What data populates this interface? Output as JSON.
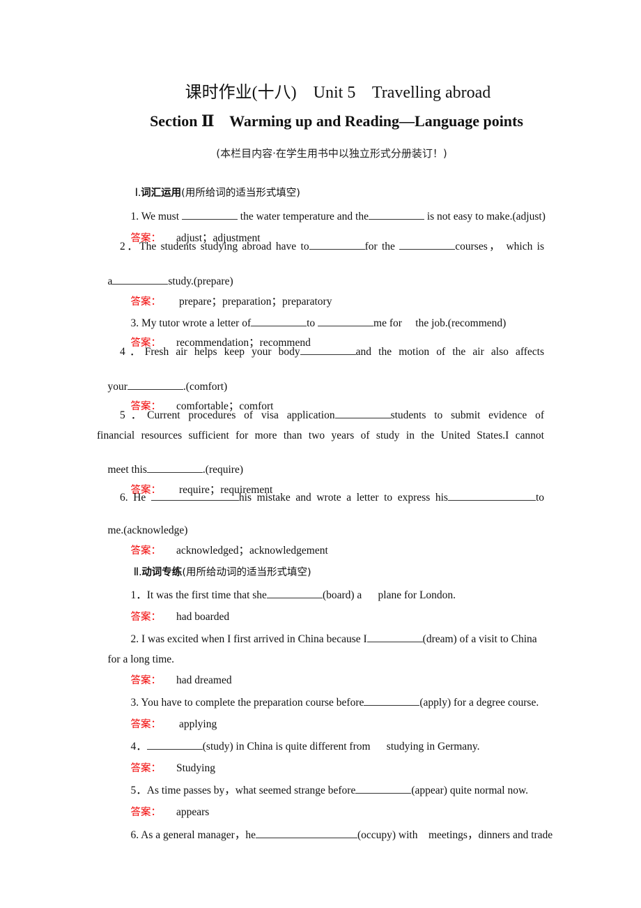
{
  "header": {
    "title": "课时作业(十八)    Unit 5    Travelling abroad",
    "subtitle": "Section Ⅱ    Warming up and Reading—Language points",
    "note": "(本栏目内容·在学生用书中以独立形式分册装订！)"
  },
  "answer_label": "答案：",
  "sections": [
    {
      "numeral": "Ⅰ.",
      "heading": "词汇运用",
      "instruction": "(用所给词的适当形式填空)",
      "items": [
        {
          "parts": [
            "1. We must ",
            " the water temperature and the",
            " is not easy to make.(adjust)"
          ],
          "answer": "adjust；adjustment"
        },
        {
          "line1": [
            "2．The students studying abroad have to",
            "for the ",
            "courses， which is"
          ],
          "line2": [
            "a",
            "study.(prepare)"
          ],
          "answer": "prepare；preparation；preparatory"
        },
        {
          "parts": [
            "3. My tutor wrote a letter of",
            "to ",
            "me for     the job.(recommend)"
          ],
          "answer": "recommendation；recommend"
        },
        {
          "line1": [
            "4．Fresh air helps keep your body",
            "and the motion       of the air also affects"
          ],
          "line2": [
            "your",
            ".(comfort)"
          ],
          "answer": "comfortable；comfort"
        },
        {
          "line1": [
            "5．Current procedures of visa application",
            "students       to submit evidence of"
          ],
          "line2": "financial resources sufficient for      more than two years of study in the United States.I cannot",
          "line3": [
            "meet this",
            ".(require)"
          ],
          "answer": "require；requirement"
        },
        {
          "line1": [
            "6. He ",
            "his mistake and wrote a letter to express    his",
            "to"
          ],
          "line2": "me.(acknowledge)",
          "answer": "acknowledged；acknowledgement"
        }
      ]
    },
    {
      "numeral": "Ⅱ.",
      "heading": "动词专练",
      "instruction": "(用所给动词的适当形式填空)",
      "items": [
        {
          "parts": [
            "1．It was the first time that she",
            "(board) a      plane for London."
          ],
          "answer": "had boarded"
        },
        {
          "line1": [
            "2. I was excited when I first arrived in China because I",
            "(dream) of a visit to China"
          ],
          "line2": "for a long time.",
          "answer": "had dreamed"
        },
        {
          "parts": [
            "3. You have to complete the preparation course before",
            "(apply) for a degree course."
          ],
          "answer": "applying"
        },
        {
          "parts": [
            "4．",
            "(study) in China is quite different from      studying in Germany."
          ],
          "answer": "Studying"
        },
        {
          "parts": [
            "5．As time passes by，what seemed strange before",
            "(appear) quite normal now."
          ],
          "answer": "appears"
        },
        {
          "parts": [
            "6. As a general manager，he",
            "(occupy) with    meetings，dinners and trade"
          ]
        }
      ]
    }
  ]
}
